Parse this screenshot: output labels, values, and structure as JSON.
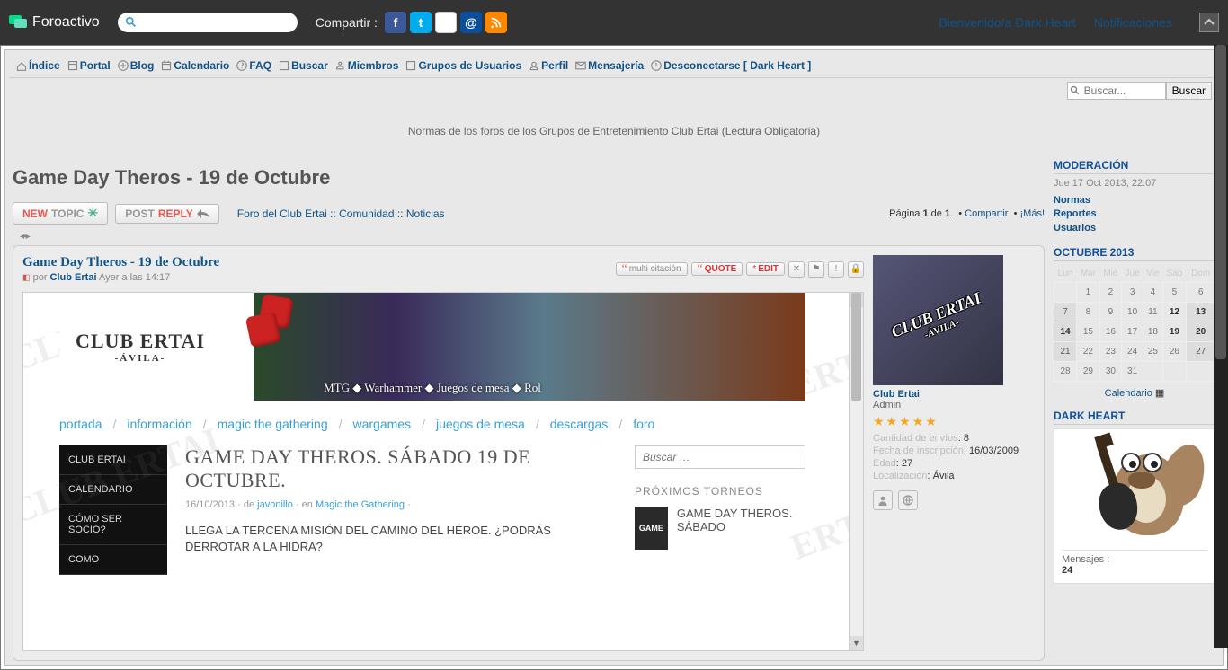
{
  "topbar": {
    "brand": "Foroactivo",
    "share_label": "Compartir :",
    "welcome": "Bienvenido/a Dark Heart",
    "notifications": "Notificaciones"
  },
  "nav": {
    "items": [
      {
        "label": "Índice",
        "icon": "home-icon"
      },
      {
        "label": "Portal",
        "icon": "portal-icon"
      },
      {
        "label": "Blog",
        "icon": "blog-icon"
      },
      {
        "label": "Calendario",
        "icon": "calendar-icon"
      },
      {
        "label": "FAQ",
        "icon": "faq-icon"
      },
      {
        "label": "Buscar",
        "icon": "search-icon"
      },
      {
        "label": "Miembros",
        "icon": "members-icon"
      },
      {
        "label": "Grupos de Usuarios",
        "icon": "groups-icon"
      },
      {
        "label": "Perfil",
        "icon": "profile-icon"
      },
      {
        "label": "Mensajería",
        "icon": "mail-icon"
      },
      {
        "label": "Desconectarse [ Dark Heart ]",
        "icon": "logout-icon"
      }
    ]
  },
  "search": {
    "placeholder": "Buscar...",
    "submit": "Buscar"
  },
  "announcement": "Normas de los foros de los Grupos de Entretenimiento Club Ertai (Lectura Obligatoria)",
  "page": {
    "title": "Game Day Theros - 19 de Octubre",
    "newtopic1": "NEW",
    "newtopic2": "TOPIC",
    "postreply1": "POST",
    "postreply2": "REPLY",
    "breadcrumb": "Foro del Club Ertai :: Comunidad :: Noticias",
    "pagination_prefix": "Página ",
    "page_cur": "1",
    "page_of": " de ",
    "page_total": "1",
    "share": "Compartir",
    "more": "¡Más!"
  },
  "post": {
    "title": "Game Day Theros - 19 de Octubre",
    "by": "por ",
    "author": "Club Ertai",
    "when": " Ayer a las 14:17",
    "btn_multi": "multi citación",
    "btn_quote": "QUOTE",
    "btn_edit": "EDIT"
  },
  "embed": {
    "logo_main": "CLUB ERTAI",
    "logo_sub": "-ÁVILA-",
    "tagline": "MTG ◆ Warhammer ◆ Juegos de mesa ◆ Rol",
    "nav": [
      "portada",
      "información",
      "magic the gathering",
      "wargames",
      "juegos de mesa",
      "descargas",
      "foro"
    ],
    "side": [
      "CLUB ERTAI",
      "CALENDARIO",
      "CÓMO SER SOCIO?",
      "COMO"
    ],
    "headline": "GAME DAY THEROS. SÁBADO 19 DE OCTUBRE.",
    "meta_date": "16/10/2013",
    "meta_by": " · de ",
    "meta_author": "javonillo",
    "meta_in": " · en ",
    "meta_cat": "Magic the Gathering",
    "meta_dot": " ·",
    "body": "LLEGA LA TERCENA MISIÓN DEL CAMINO DEL HÉROE. ¿PODRÁS DERROTAR A LA HIDRA?",
    "search_ph": "Buscar …",
    "right_head": "PRÓXIMOS TORNEOS",
    "tourn_img": "GAME",
    "tourn_title": "GAME DAY THEROS. SÁBADO"
  },
  "author": {
    "name": "Club Ertai",
    "rank": "Admin",
    "avatar_main": "CLUB ERTAI",
    "avatar_sub": "-ÁVILA-",
    "fields": [
      {
        "label": "Cantidad de envíos",
        "val": "8"
      },
      {
        "label": "Fecha de inscripción",
        "val": "16/03/2009"
      },
      {
        "label": "Edad",
        "val": "27"
      },
      {
        "label": "Localización",
        "val": "Ávila"
      }
    ]
  },
  "sidebar": {
    "mod_title": "MODERACIÓN",
    "mod_date": "Jue 17 Oct 2013, 22:07",
    "mod_links": [
      "Normas",
      "Reportes",
      "Usuarios"
    ],
    "cal_title": "OCTUBRE 2013",
    "cal_days": [
      "Lun",
      "Mar",
      "Mié",
      "Jue",
      "Vie",
      "Sáb",
      "Dom"
    ],
    "cal_rows": [
      [
        {
          "n": "",
          "c": ""
        },
        {
          "n": "1",
          "c": ""
        },
        {
          "n": "2",
          "c": ""
        },
        {
          "n": "3",
          "c": ""
        },
        {
          "n": "4",
          "c": ""
        },
        {
          "n": "5",
          "c": ""
        },
        {
          "n": "6",
          "c": ""
        }
      ],
      [
        {
          "n": "7",
          "c": "out"
        },
        {
          "n": "8",
          "c": ""
        },
        {
          "n": "9",
          "c": ""
        },
        {
          "n": "10",
          "c": ""
        },
        {
          "n": "11",
          "c": ""
        },
        {
          "n": "12",
          "c": "bold"
        },
        {
          "n": "13",
          "c": "bold out"
        }
      ],
      [
        {
          "n": "14",
          "c": "bold out"
        },
        {
          "n": "15",
          "c": ""
        },
        {
          "n": "16",
          "c": ""
        },
        {
          "n": "17",
          "c": ""
        },
        {
          "n": "18",
          "c": ""
        },
        {
          "n": "19",
          "c": "bold"
        },
        {
          "n": "20",
          "c": "bold out"
        }
      ],
      [
        {
          "n": "21",
          "c": "out"
        },
        {
          "n": "22",
          "c": ""
        },
        {
          "n": "23",
          "c": ""
        },
        {
          "n": "24",
          "c": ""
        },
        {
          "n": "25",
          "c": ""
        },
        {
          "n": "26",
          "c": ""
        },
        {
          "n": "27",
          "c": "out"
        }
      ],
      [
        {
          "n": "28",
          "c": ""
        },
        {
          "n": "29",
          "c": ""
        },
        {
          "n": "30",
          "c": ""
        },
        {
          "n": "31",
          "c": ""
        },
        {
          "n": "",
          "c": ""
        },
        {
          "n": "",
          "c": ""
        },
        {
          "n": "",
          "c": ""
        }
      ]
    ],
    "cal_link": "Calendario",
    "user_title": "DARK HEART",
    "msg_label": "Mensajes :",
    "msg_count": "24"
  }
}
